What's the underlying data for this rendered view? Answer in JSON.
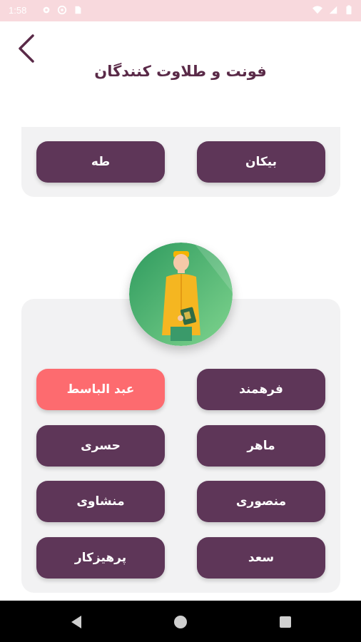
{
  "status_bar": {
    "time": "1:58"
  },
  "header": {
    "title": "فونت و طلاوت کنندگان"
  },
  "fonts": [
    {
      "label": "بیکان",
      "selected": false
    },
    {
      "label": "طه",
      "selected": false
    }
  ],
  "reciters": [
    {
      "label": "فرهمند",
      "selected": false
    },
    {
      "label": "عبد الباسط",
      "selected": true
    },
    {
      "label": "ماهر",
      "selected": false
    },
    {
      "label": "حسری",
      "selected": false
    },
    {
      "label": "منصوری",
      "selected": false
    },
    {
      "label": "منشاوی",
      "selected": false
    },
    {
      "label": "سعد",
      "selected": false
    },
    {
      "label": "پرهیزکار",
      "selected": false
    }
  ],
  "colors": {
    "accent": "#5e3658",
    "selected": "#fd6b6f",
    "card_bg": "#f2f2f3",
    "status_bar": "#f8d9dd"
  }
}
